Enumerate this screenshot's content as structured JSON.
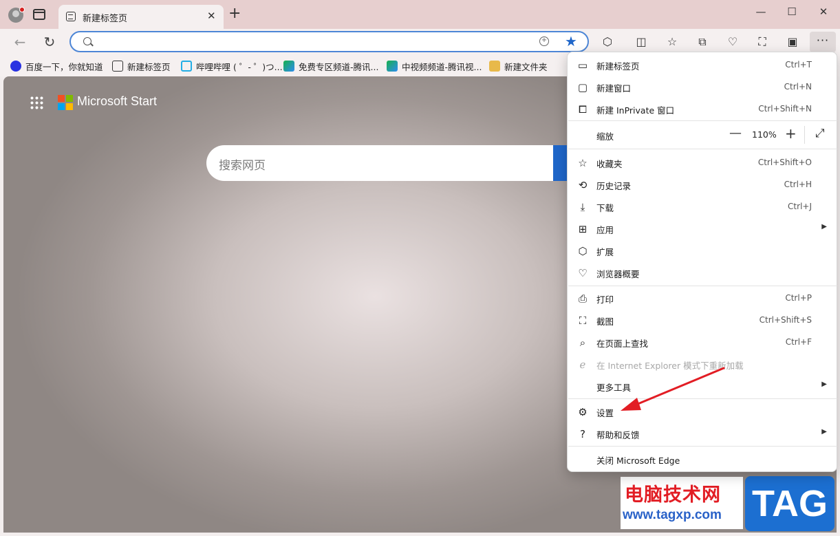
{
  "tab": {
    "title": "新建标签页",
    "close": "✕",
    "new_tab": "+"
  },
  "window": {
    "minimize": "—",
    "maximize": "☐",
    "close": "✕"
  },
  "nav": {
    "back": "←",
    "refresh": "↻"
  },
  "address": {
    "value": "",
    "placeholder": ""
  },
  "favorites": [
    {
      "label": "百度一下，你就知道",
      "color": "#2932e1"
    },
    {
      "label": "新建标签页",
      "color": "#333333"
    },
    {
      "label": "哔哩哔哩 ( ゜- ゜)つ...",
      "color": "#23ade5"
    },
    {
      "label": "免费专区频道-腾讯...",
      "color": "#18b04c"
    },
    {
      "label": "中视频频道-腾讯视...",
      "color": "#18b04c"
    },
    {
      "label": "新建文件夹",
      "color": "#e8b94a"
    }
  ],
  "page": {
    "brand": "Microsoft Start",
    "search_placeholder": "搜索网页"
  },
  "menu": {
    "new_tab": {
      "label": "新建标签页",
      "shortcut": "Ctrl+T"
    },
    "new_window": {
      "label": "新建窗口",
      "shortcut": "Ctrl+N"
    },
    "new_inprivate": {
      "label": "新建 InPrivate 窗口",
      "shortcut": "Ctrl+Shift+N"
    },
    "zoom": {
      "label": "缩放",
      "value": "110%",
      "minus": "—",
      "plus": "+"
    },
    "favorites": {
      "label": "收藏夹",
      "shortcut": "Ctrl+Shift+O"
    },
    "history": {
      "label": "历史记录",
      "shortcut": "Ctrl+H"
    },
    "downloads": {
      "label": "下载",
      "shortcut": "Ctrl+J"
    },
    "apps": {
      "label": "应用"
    },
    "extensions": {
      "label": "扩展"
    },
    "essentials": {
      "label": "浏览器概要"
    },
    "print": {
      "label": "打印",
      "shortcut": "Ctrl+P"
    },
    "screenshot": {
      "label": "截图",
      "shortcut": "Ctrl+Shift+S"
    },
    "find": {
      "label": "在页面上查找",
      "shortcut": "Ctrl+F"
    },
    "ie_mode": {
      "label": "在 Internet Explorer 模式下重新加载"
    },
    "more_tools": {
      "label": "更多工具"
    },
    "settings": {
      "label": "设置"
    },
    "help": {
      "label": "帮助和反馈"
    },
    "close": {
      "label": "关闭 Microsoft Edge"
    }
  },
  "watermark": {
    "cn": "电脑技术网",
    "url": "www.tagxp.com",
    "tag": "TAG"
  },
  "colors": {
    "accent": "#1f66c9",
    "arrow": "#e21d24",
    "tab_strip": "#e7cfcf"
  }
}
